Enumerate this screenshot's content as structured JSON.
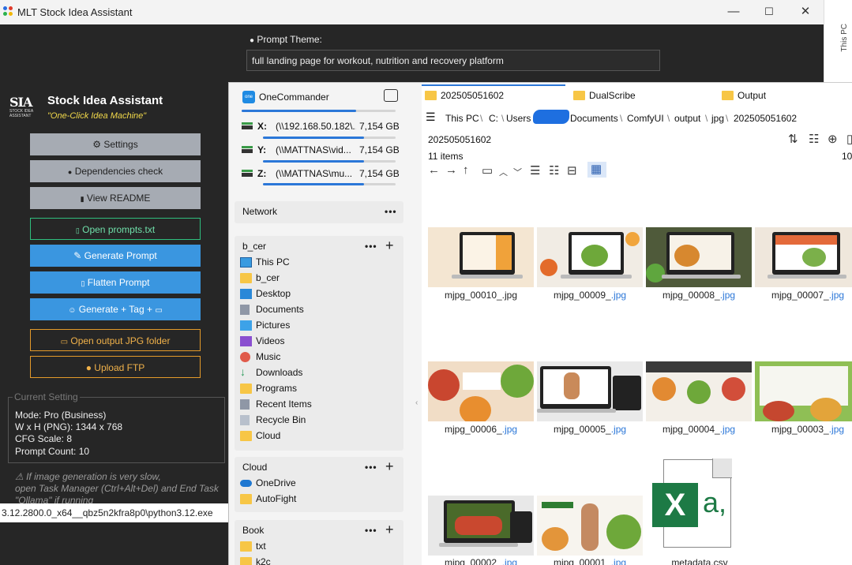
{
  "mlt": {
    "title": "MLT Stock Idea Assistant",
    "prompt_theme_label": "Prompt Theme:",
    "prompt_theme_value": "full landing page for workout, nutrition and recovery platform",
    "logo_text": "SIA",
    "logo_subtext": "STOCK IDEA ASSISTANT",
    "app_title": "Stock Idea Assistant",
    "app_subtitle": "\"One-Click Idea Machine\"",
    "buttons": {
      "settings": "Settings",
      "dependencies": "Dependencies check",
      "readme": "View README",
      "open_prompts": "Open prompts.txt",
      "generate_prompt": "Generate Prompt",
      "flatten_prompt": "Flatten Prompt",
      "generate_tag": "Generate + Tag +",
      "open_output": "Open output JPG folder",
      "upload_ftp": "Upload FTP"
    },
    "current_setting_label": "Current Setting",
    "current": {
      "mode": "Mode: Pro (Business)",
      "size": "W x H (PNG): 1344 x 768",
      "cfg": "CFG Scale: 8",
      "count": "Prompt Count: 10"
    },
    "warning_1": "⚠ If image generation is very slow,",
    "warning_2": "open Task Manager (Ctrl+Alt+Del) and End Task",
    "warning_3": "\"Ollama\" if running",
    "statusbar": "3.12.2800.0_x64__qbz5n2kfra8p0\\python3.12.exe"
  },
  "background_window": {
    "strip_label": "This PC"
  },
  "onecommander": {
    "app_name": "OneCommander",
    "drives": [
      {
        "letter": "X:",
        "path": "(\\\\192.168.50.182\\...",
        "size": "7,154 GB",
        "fill": 0.76
      },
      {
        "letter": "Y:",
        "path": "(\\\\MATTNAS\\vid...",
        "size": "7,154 GB",
        "fill": 0.76
      },
      {
        "letter": "Z:",
        "path": "(\\\\MATTNAS\\mu...",
        "size": "7,154 GB",
        "fill": 0.76
      }
    ],
    "network_label": "Network",
    "b_cer_label": "b_cer",
    "b_cer_items": [
      "This PC",
      "b_cer",
      "Desktop",
      "Documents",
      "Pictures",
      "Videos",
      "Music",
      "Downloads",
      "Programs",
      "Recent Items",
      "Recycle Bin",
      "Cloud"
    ],
    "cloud_label": "Cloud",
    "cloud_items": [
      "OneDrive",
      "AutoFight"
    ],
    "book_label": "Book",
    "book_items": [
      "txt",
      "k2c"
    ],
    "tabs": [
      "202505051602",
      "DualScribe",
      "Output"
    ],
    "breadcrumb": [
      "This PC",
      "C:",
      "Users",
      "Documents",
      "ComfyUI",
      "output",
      "jpg",
      "202505051602"
    ],
    "current_folder": "202505051602",
    "item_count": "11 items",
    "right_number": "10.",
    "files": [
      {
        "name": "mjpg_00010_.jpg",
        "ext": ""
      },
      {
        "name": "mjpg_00009_",
        "ext": ".jpg"
      },
      {
        "name": "mjpg_00008_",
        "ext": ".jpg"
      },
      {
        "name": "mjpg_00007_",
        "ext": ".jpg"
      },
      {
        "name": "mjpg_00006_",
        "ext": ".jpg"
      },
      {
        "name": "mjpg_00005_",
        "ext": ".jpg"
      },
      {
        "name": "mjpg_00004_",
        "ext": ".jpg"
      },
      {
        "name": "mjpg_00003_",
        "ext": ".jpg"
      },
      {
        "name": "mjpg_00002_",
        "ext": ".jpg"
      },
      {
        "name": "mjpg_00001_",
        "ext": ".jpg"
      },
      {
        "name": "metadata.csv",
        "ext": ""
      }
    ],
    "excel_letter": "X",
    "excel_glyph": "a,"
  },
  "colors": {
    "accent_blue": "#3a96e0",
    "accent_green": "#2fbf7e",
    "accent_orange": "#e49a2a",
    "subtitle_yellow": "#f2d94a",
    "excel_green": "#1d7a45"
  }
}
